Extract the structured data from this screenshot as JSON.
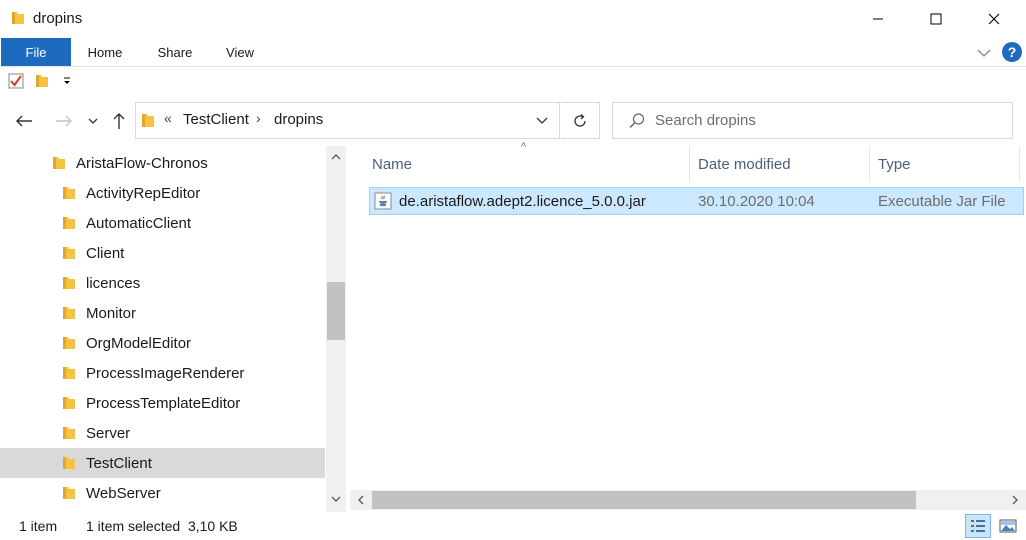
{
  "window": {
    "title": "dropins"
  },
  "ribbon": {
    "tabs": [
      "File",
      "Home",
      "Share",
      "View"
    ],
    "help_label": "?"
  },
  "address": {
    "overflow": "«",
    "crumbs": [
      "TestClient",
      "dropins"
    ],
    "separator": "›"
  },
  "search": {
    "placeholder": "Search dropins"
  },
  "nav": {
    "items": [
      "AristaFlow-Chronos",
      "ActivityRepEditor",
      "AutomaticClient",
      "Client",
      "licences",
      "Monitor",
      "OrgModelEditor",
      "ProcessImageRenderer",
      "ProcessTemplateEditor",
      "Server",
      "TestClient",
      "WebServer"
    ],
    "selected": "TestClient"
  },
  "filelist": {
    "columns": [
      "Name",
      "Date modified",
      "Type"
    ],
    "sort_indicator": "^",
    "rows": [
      {
        "name": "de.aristaflow.adept2.licence_5.0.0.jar",
        "date": "30.10.2020 10:04",
        "type": "Executable Jar File",
        "icon": "java-jar-icon"
      }
    ]
  },
  "status": {
    "count": "1 item",
    "selected": "1 item selected  3,10 KB"
  },
  "colors": {
    "accent": "#1c6bbf",
    "selection": "#cce8ff",
    "folder": "#f5c242"
  }
}
